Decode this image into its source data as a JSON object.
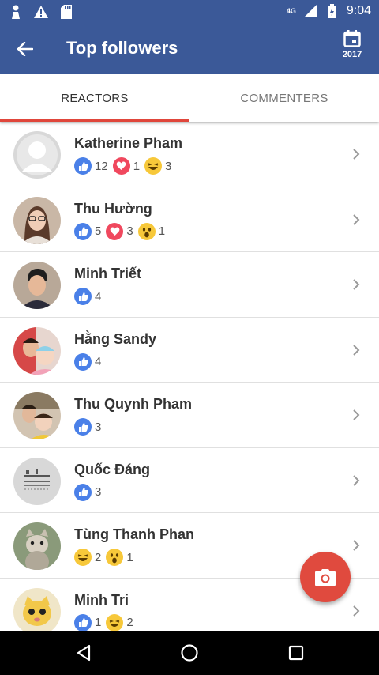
{
  "status_bar": {
    "network": "4G",
    "time": "9:04"
  },
  "app_bar": {
    "title": "Top followers",
    "calendar_year": "2017"
  },
  "tabs": [
    {
      "label": "REACTORS",
      "active": true
    },
    {
      "label": "COMMENTERS",
      "active": false
    }
  ],
  "colors": {
    "brand": "#3b5998",
    "accent": "#e0463b",
    "like": "#4a80e8",
    "love": "#f0485e",
    "haha": "#f7c83a"
  },
  "followers": [
    {
      "name": "Katherine Pham",
      "avatar": "default-avatar",
      "reactions": [
        {
          "type": "like",
          "count": "12"
        },
        {
          "type": "love",
          "count": "1"
        },
        {
          "type": "haha",
          "count": "3"
        }
      ]
    },
    {
      "name": "Thu Hường",
      "avatar": "photo-avatar",
      "reactions": [
        {
          "type": "like",
          "count": "5"
        },
        {
          "type": "love",
          "count": "3"
        },
        {
          "type": "wow",
          "count": "1"
        }
      ]
    },
    {
      "name": "Minh Triết",
      "avatar": "photo-avatar",
      "reactions": [
        {
          "type": "like",
          "count": "4"
        }
      ]
    },
    {
      "name": "Hằng Sandy",
      "avatar": "photo-avatar",
      "reactions": [
        {
          "type": "like",
          "count": "4"
        }
      ]
    },
    {
      "name": "Thu Quynh Pham",
      "avatar": "photo-avatar",
      "reactions": [
        {
          "type": "like",
          "count": "3"
        }
      ]
    },
    {
      "name": "Quốc Đáng",
      "avatar": "sketch-avatar",
      "reactions": [
        {
          "type": "like",
          "count": "3"
        }
      ]
    },
    {
      "name": "Tùng Thanh Phan",
      "avatar": "cat-avatar",
      "reactions": [
        {
          "type": "haha",
          "count": "2"
        },
        {
          "type": "wow",
          "count": "1"
        }
      ]
    },
    {
      "name": "Minh Tri",
      "avatar": "cat-avatar",
      "reactions": [
        {
          "type": "like",
          "count": "1"
        },
        {
          "type": "haha",
          "count": "2"
        }
      ]
    }
  ],
  "fab": {
    "icon": "camera-icon"
  },
  "nav_bar": {
    "icons": [
      "back-triangle-icon",
      "home-circle-icon",
      "recents-square-icon"
    ]
  }
}
